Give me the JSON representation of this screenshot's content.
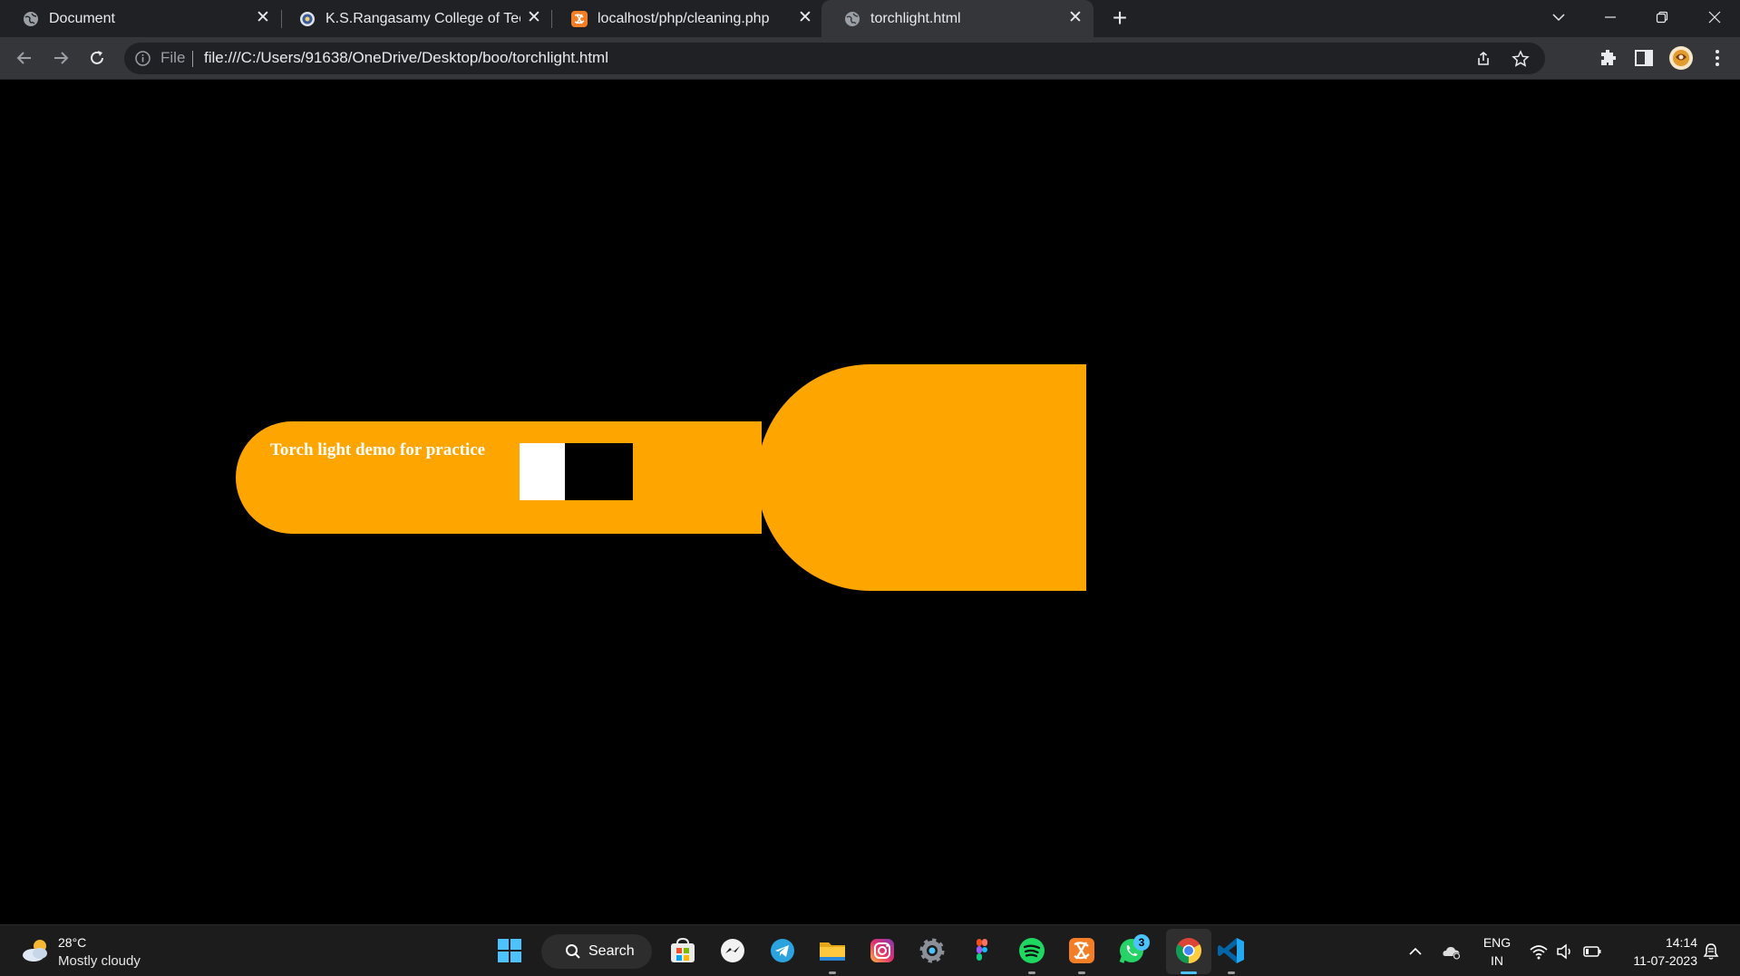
{
  "browser": {
    "tabs": [
      {
        "title": "Document",
        "icon": "globe-icon",
        "active": false
      },
      {
        "title": "K.S.Rangasamy College of Techno",
        "icon": "college-logo-icon",
        "active": false
      },
      {
        "title": "localhost/php/cleaning.php",
        "icon": "xampp-icon",
        "active": false
      },
      {
        "title": "torchlight.html",
        "icon": "globe-icon",
        "active": true
      }
    ],
    "new_tab_label": "+",
    "close_glyph": "✕"
  },
  "toolbar": {
    "scheme_label": "File",
    "url": "file:///C:/Users/91638/OneDrive/Desktop/boo/torchlight.html"
  },
  "page": {
    "torch_text": "Torch light demo for practice",
    "switch_state": "off",
    "colors": {
      "background": "#000000",
      "torch": "#ffa500",
      "switch_knob": "#ffffff",
      "switch_track": "#000000"
    }
  },
  "taskbar": {
    "weather": {
      "temp": "28°C",
      "description": "Mostly cloudy"
    },
    "search_label": "Search",
    "whatsapp_badge": "3",
    "language": {
      "line1": "ENG",
      "line2": "IN"
    },
    "clock": {
      "time": "14:14",
      "date": "11-07-2023"
    },
    "apps": [
      "windows-start-icon",
      "search-icon",
      "microsoft-store-icon",
      "messenger-icon",
      "telegram-icon",
      "file-explorer-icon",
      "instagram-icon",
      "settings-icon",
      "figma-icon",
      "spotify-icon",
      "xampp-icon",
      "whatsapp-icon",
      "chrome-icon",
      "vscode-icon"
    ]
  }
}
